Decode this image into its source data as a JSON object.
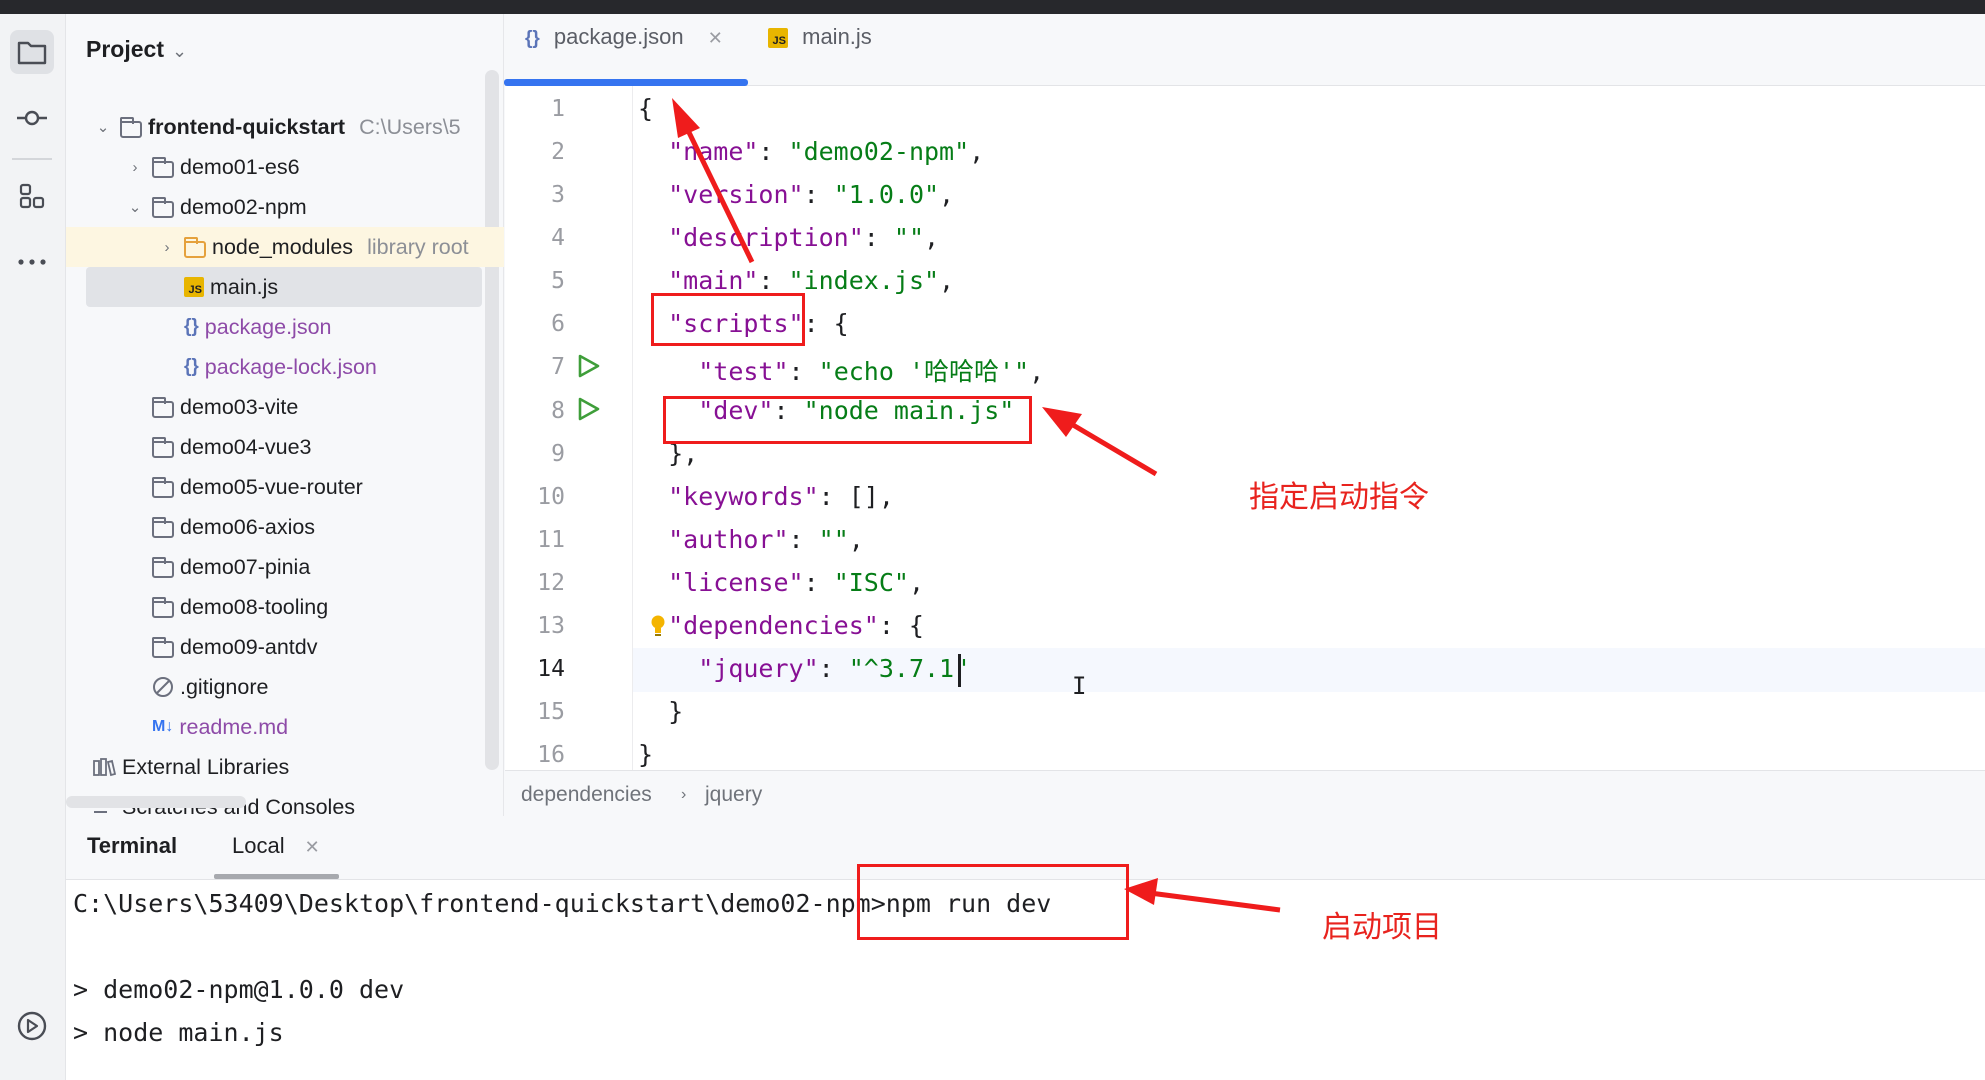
{
  "project_panel": {
    "title": "Project",
    "tree": [
      {
        "label": "frontend-quickstart",
        "hint": "C:\\Users\\5"
      },
      {
        "label": "demo01-es6"
      },
      {
        "label": "demo02-npm"
      },
      {
        "label": "node_modules",
        "hint": "library root"
      },
      {
        "label": "main.js"
      },
      {
        "label": "package.json"
      },
      {
        "label": "package-lock.json"
      },
      {
        "label": "demo03-vite"
      },
      {
        "label": "demo04-vue3"
      },
      {
        "label": "demo05-vue-router"
      },
      {
        "label": "demo06-axios"
      },
      {
        "label": "demo07-pinia"
      },
      {
        "label": "demo08-tooling"
      },
      {
        "label": "demo09-antdv"
      },
      {
        "label": ".gitignore"
      },
      {
        "label": "readme.md",
        "badge": "M↓"
      },
      {
        "label": "External Libraries"
      },
      {
        "label": "Scratches and Consoles"
      }
    ]
  },
  "editor": {
    "tabs": [
      {
        "label": "package.json",
        "icon": "json-braces-icon",
        "active": true
      },
      {
        "label": "main.js",
        "icon": "js-file-icon",
        "active": false
      }
    ],
    "lines": [
      {
        "n": "1",
        "segments": [
          [
            "p",
            "{"
          ]
        ]
      },
      {
        "n": "2",
        "segments": [
          [
            "p",
            "  "
          ],
          [
            "k",
            "\"name\""
          ],
          [
            "p",
            ": "
          ],
          [
            "s",
            "\"demo02-npm\""
          ],
          [
            "p",
            ","
          ]
        ]
      },
      {
        "n": "3",
        "segments": [
          [
            "p",
            "  "
          ],
          [
            "k",
            "\"version\""
          ],
          [
            "p",
            ": "
          ],
          [
            "s",
            "\"1.0.0\""
          ],
          [
            "p",
            ","
          ]
        ]
      },
      {
        "n": "4",
        "segments": [
          [
            "p",
            "  "
          ],
          [
            "k",
            "\"description\""
          ],
          [
            "p",
            ": "
          ],
          [
            "s",
            "\"\""
          ],
          [
            "p",
            ","
          ]
        ]
      },
      {
        "n": "5",
        "segments": [
          [
            "p",
            "  "
          ],
          [
            "k",
            "\"main\""
          ],
          [
            "p",
            ": "
          ],
          [
            "s",
            "\"index.js\""
          ],
          [
            "p",
            ","
          ]
        ]
      },
      {
        "n": "6",
        "segments": [
          [
            "p",
            "  "
          ],
          [
            "k",
            "\"scripts\""
          ],
          [
            "p",
            ": {"
          ]
        ]
      },
      {
        "n": "7",
        "segments": [
          [
            "p",
            "    "
          ],
          [
            "k",
            "\"test\""
          ],
          [
            "p",
            ": "
          ],
          [
            "s",
            "\"echo '哈哈哈'\""
          ],
          [
            "p",
            ","
          ]
        ]
      },
      {
        "n": "8",
        "segments": [
          [
            "p",
            "    "
          ],
          [
            "k",
            "\"dev\""
          ],
          [
            "p",
            ": "
          ],
          [
            "s",
            "\"node main.js\""
          ]
        ]
      },
      {
        "n": "9",
        "segments": [
          [
            "p",
            "  },"
          ]
        ]
      },
      {
        "n": "10",
        "segments": [
          [
            "p",
            "  "
          ],
          [
            "k",
            "\"keywords\""
          ],
          [
            "p",
            ": [],"
          ]
        ]
      },
      {
        "n": "11",
        "segments": [
          [
            "p",
            "  "
          ],
          [
            "k",
            "\"author\""
          ],
          [
            "p",
            ": "
          ],
          [
            "s",
            "\"\""
          ],
          [
            "p",
            ","
          ]
        ]
      },
      {
        "n": "12",
        "segments": [
          [
            "p",
            "  "
          ],
          [
            "k",
            "\"license\""
          ],
          [
            "p",
            ": "
          ],
          [
            "s",
            "\"ISC\""
          ],
          [
            "p",
            ","
          ]
        ]
      },
      {
        "n": "13",
        "segments": [
          [
            "p",
            "  "
          ],
          [
            "k",
            "\"dependencies\""
          ],
          [
            "p",
            ": {"
          ]
        ]
      },
      {
        "n": "14",
        "segments": [
          [
            "p",
            "    "
          ],
          [
            "k",
            "\"jquery\""
          ],
          [
            "p",
            ": "
          ],
          [
            "s",
            "\"^3.7.1\""
          ]
        ]
      },
      {
        "n": "15",
        "segments": [
          [
            "p",
            "  }"
          ]
        ]
      },
      {
        "n": "16",
        "segments": [
          [
            "p",
            "}"
          ]
        ]
      }
    ],
    "breadcrumbs": [
      "dependencies",
      "jquery"
    ]
  },
  "terminal": {
    "title": "Terminal",
    "tab": "Local",
    "lines": [
      "C:\\Users\\53409\\Desktop\\frontend-quickstart\\demo02-npm>npm run dev",
      "",
      "> demo02-npm@1.0.0 dev",
      "> node main.js"
    ]
  },
  "annotations": {
    "command_note": "指定启动指令",
    "start_note": "启动项目"
  },
  "colors": {
    "accent": "#3574f0",
    "annotation_red": "#ef1c1c",
    "json_key": "#871094",
    "json_string": "#067d17"
  }
}
